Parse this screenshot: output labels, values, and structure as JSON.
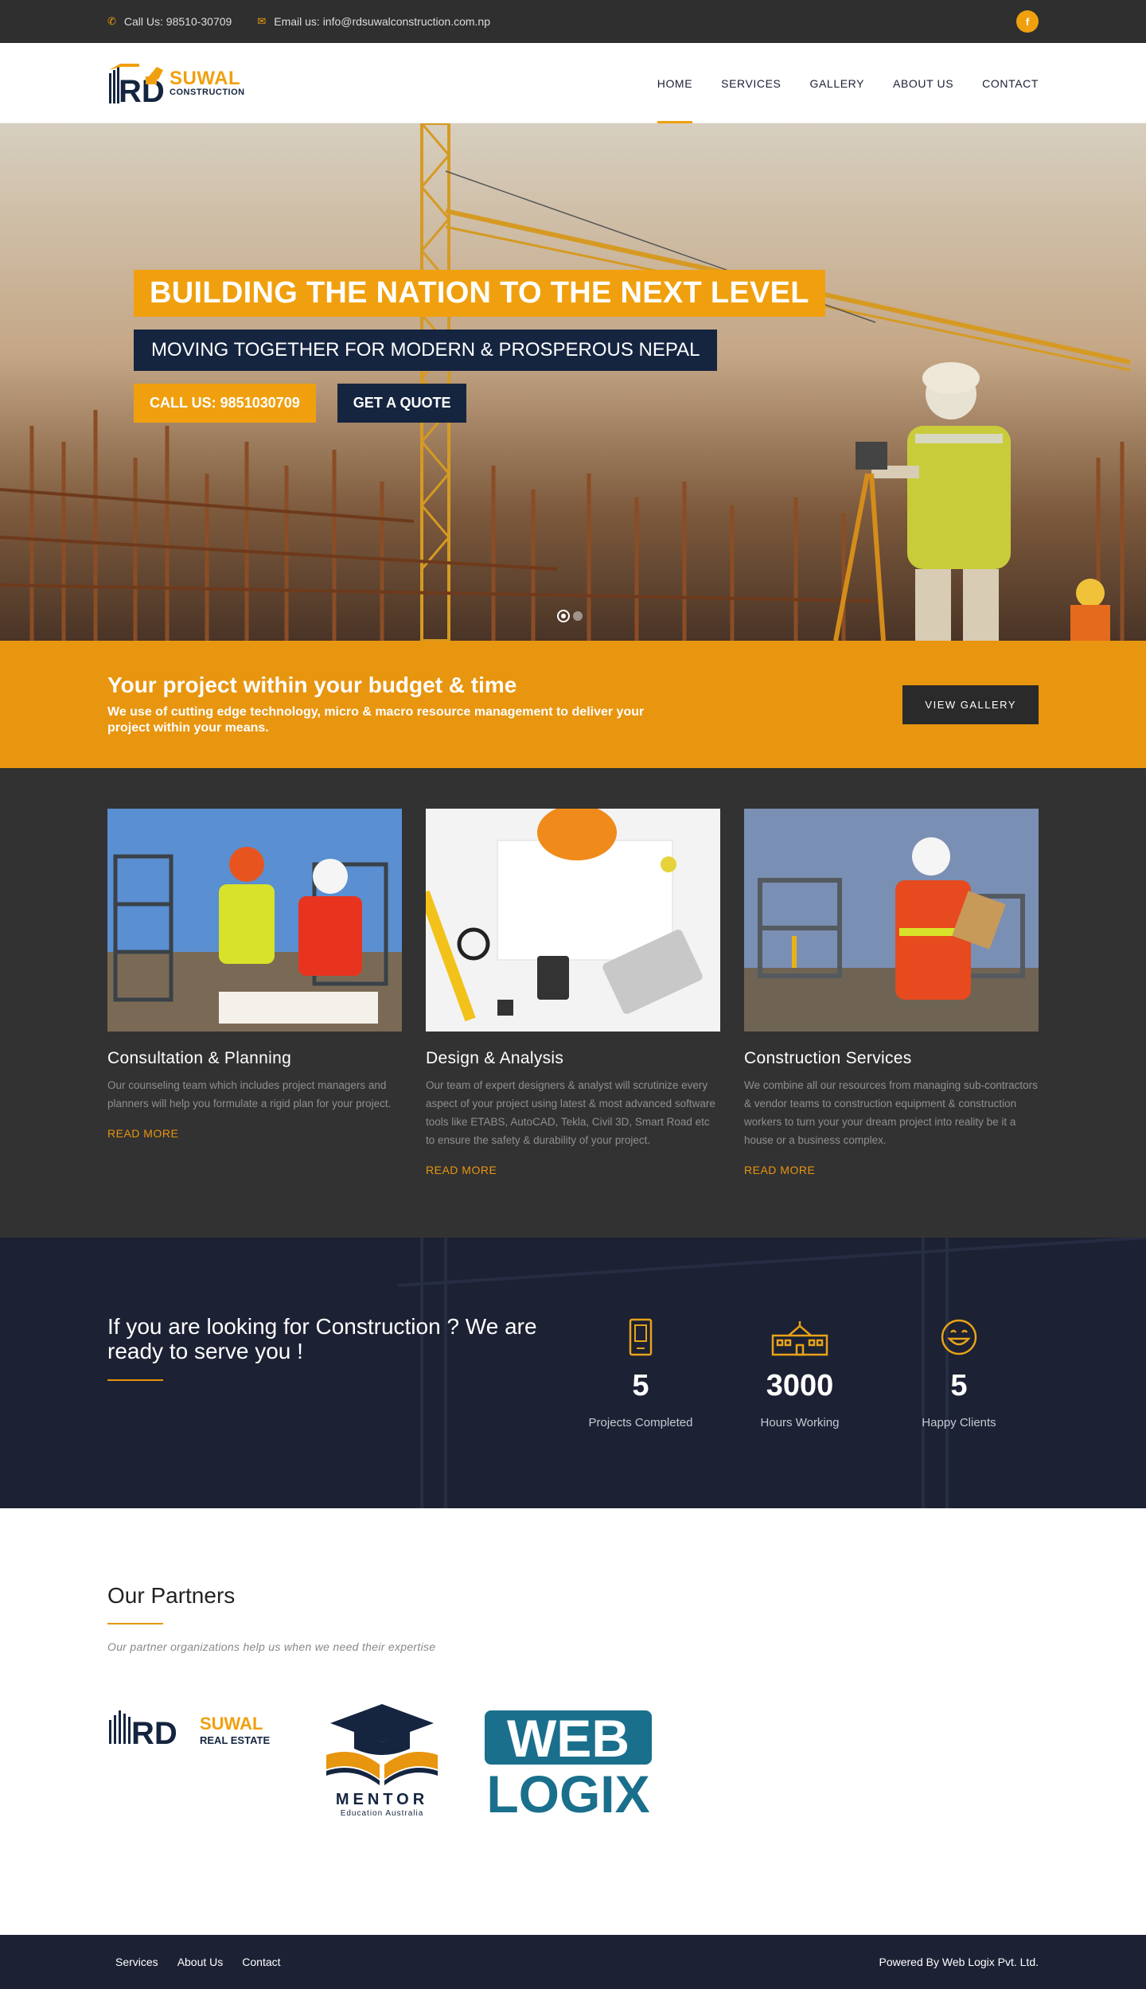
{
  "topbar": {
    "phone": "Call Us: 98510-30709",
    "email": "Email us: info@rdsuwalconstruction.com.np",
    "facebook": "f"
  },
  "brand": {
    "name": "SUWAL",
    "tagline": "CONSTRUCTION",
    "mark": "RD",
    "accent": "#f0a00f",
    "navy": "#152540"
  },
  "nav": {
    "items": [
      "HOME",
      "SERVICES",
      "GALLERY",
      "ABOUT US",
      "CONTACT"
    ],
    "active": "HOME"
  },
  "hero": {
    "title": "BUILDING THE NATION TO THE NEXT LEVEL",
    "subtitle": "MOVING TOGETHER FOR MODERN & PROSPEROUS NEPAL",
    "call_button": "CALL US: 9851030709",
    "quote_button": "GET A QUOTE"
  },
  "cta": {
    "title": "Your project within your budget & time",
    "text": "We use of cutting edge technology, micro & macro resource management to deliver your project within your means.",
    "button": "VIEW GALLERY"
  },
  "services": [
    {
      "title": "Consultation & Planning",
      "text": "Our counseling team which includes project managers and planners will help you formulate a rigid plan for your project.",
      "link": "READ MORE"
    },
    {
      "title": "Design & Analysis",
      "text": "Our team of expert designers & analyst will scrutinize every aspect of your project using latest & most advanced software tools like ETABS, AutoCAD, Tekla, Civil 3D, Smart Road etc to ensure the safety & durability of your project.",
      "link": "READ MORE"
    },
    {
      "title": "Construction Services",
      "text": "We combine all our resources from managing sub-contractors & vendor teams to construction equipment & construction workers to turn your your dream project into reality be it a house or a business complex.",
      "link": "READ MORE"
    }
  ],
  "stats": {
    "heading": "If you are looking for Construction ? We are ready to serve you !",
    "counters": [
      {
        "icon": "tablet-icon",
        "value": "5",
        "label": "Projects Completed"
      },
      {
        "icon": "building-icon",
        "value": "3000",
        "label": "Hours Working"
      },
      {
        "icon": "smiley-icon",
        "value": "5",
        "label": "Happy Clients"
      }
    ]
  },
  "partners": {
    "title": "Our Partners",
    "subtitle": "Our partner organizations help us when we need their expertise",
    "logos": [
      {
        "name": "rd-suwal-real-estate-logo",
        "mark": "RD",
        "word": "SUWAL",
        "sub": "REAL ESTATE"
      },
      {
        "name": "mentor-education-logo",
        "word": "MENTOR",
        "sub": "Education Australia"
      },
      {
        "name": "web-logix-logo",
        "line1": "WEB",
        "line2": "LOGIX"
      }
    ]
  },
  "footer": {
    "links": [
      "Services",
      "About Us",
      "Contact"
    ],
    "powered": "Powered By Web Logix Pvt. Ltd."
  }
}
